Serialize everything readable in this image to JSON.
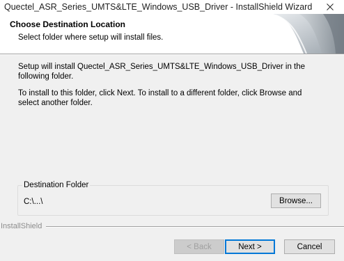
{
  "window": {
    "title": "Quectel_ASR_Series_UMTS&LTE_Windows_USB_Driver - InstallShield Wizard",
    "close_icon": "close-icon"
  },
  "header": {
    "title": "Choose Destination Location",
    "subtitle": "Select folder where setup will install files.",
    "graphic_icon": "installshield-banner-graphic"
  },
  "body": {
    "paragraph1": "Setup will install Quectel_ASR_Series_UMTS&LTE_Windows_USB_Driver in the following folder.",
    "paragraph2": "To install to this folder, click Next. To install to a different folder, click Browse and select another folder."
  },
  "destination": {
    "legend": "Destination Folder",
    "path": "C:\\...\\",
    "browse_label": "Browse..."
  },
  "footer": {
    "brand": "InstallShield",
    "back_label": "< Back",
    "next_label": "Next >",
    "cancel_label": "Cancel",
    "back_enabled": false,
    "default_button": "next"
  },
  "colors": {
    "dialog_bg": "#f0f0f0",
    "header_bg": "#ffffff",
    "default_button_border": "#0078d7",
    "disabled_text": "#a0a0a0"
  }
}
